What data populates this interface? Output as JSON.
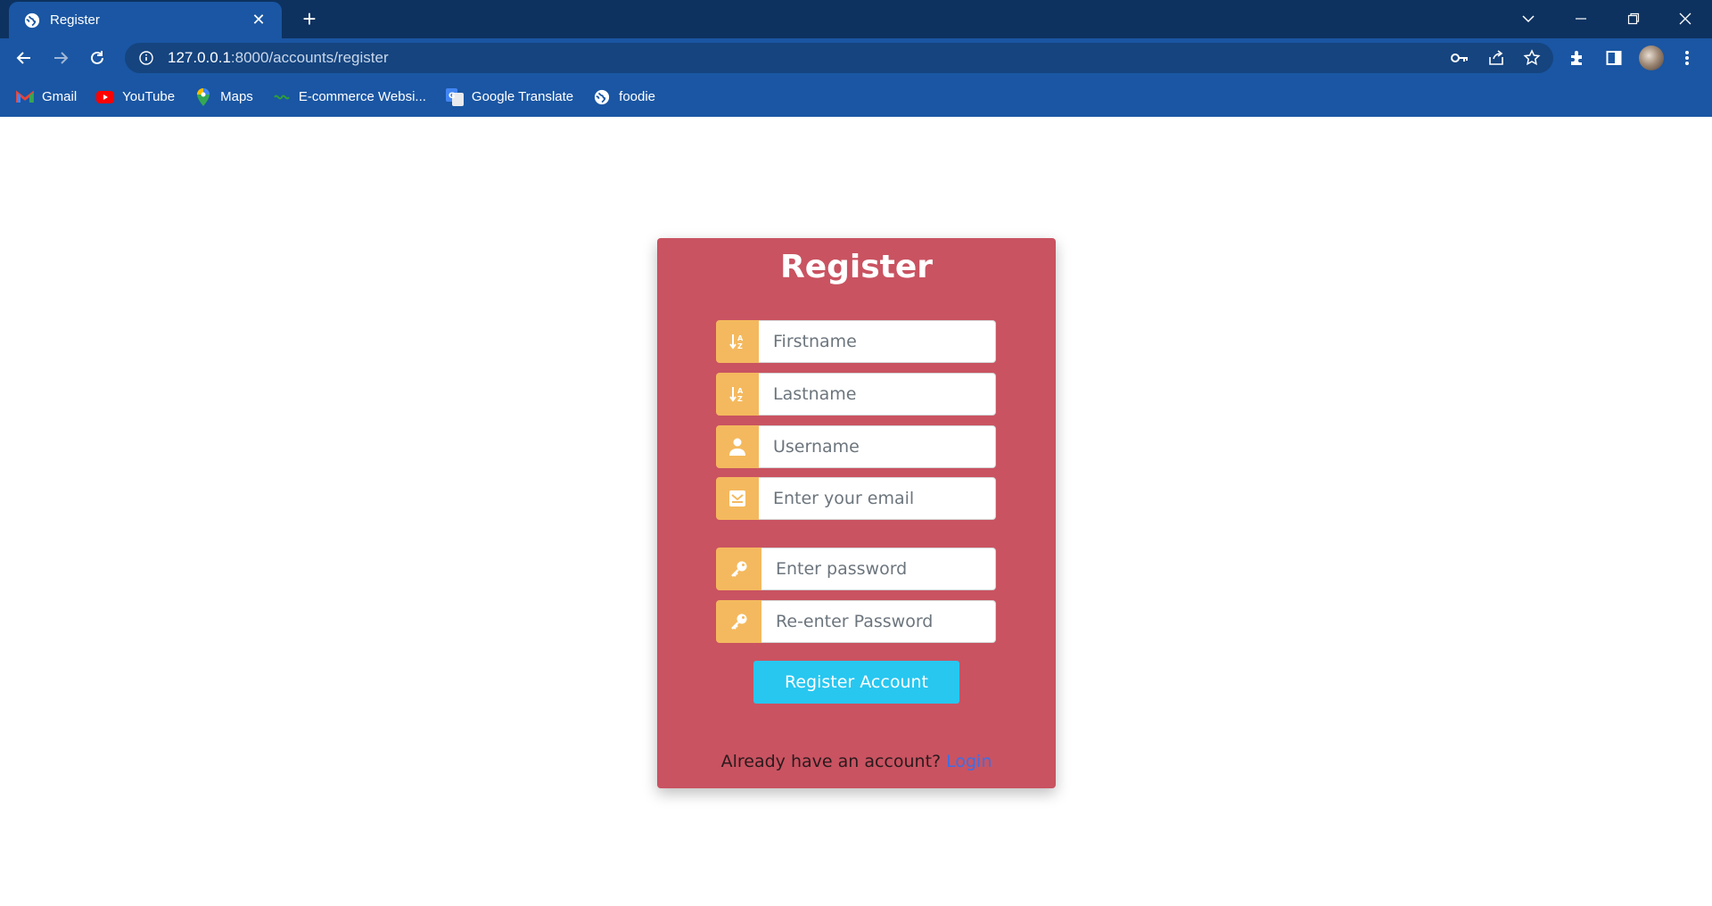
{
  "browser": {
    "tab": {
      "title": "Register",
      "close_glyph": "✕"
    },
    "new_tab_glyph": "+",
    "url": {
      "host": "127.0.0.1",
      "path": ":8000/accounts/register"
    },
    "bookmarks": [
      {
        "label": "Gmail",
        "icon": "gmail-icon"
      },
      {
        "label": "YouTube",
        "icon": "youtube-icon"
      },
      {
        "label": "Maps",
        "icon": "maps-icon"
      },
      {
        "label": "E-commerce Websi...",
        "icon": "ecommerce-icon"
      },
      {
        "label": "Google Translate",
        "icon": "translate-icon"
      },
      {
        "label": "foodie",
        "icon": "globe-icon"
      }
    ]
  },
  "form": {
    "title": "Register",
    "fields": {
      "firstname": {
        "placeholder": "Firstname",
        "icon": "sort-alpha-icon"
      },
      "lastname": {
        "placeholder": "Lastname",
        "icon": "sort-alpha-icon"
      },
      "username": {
        "placeholder": "Username",
        "icon": "user-icon"
      },
      "email": {
        "placeholder": "Enter your email",
        "icon": "envelope-icon"
      },
      "password": {
        "placeholder": "Enter password",
        "icon": "key-icon"
      },
      "password2": {
        "placeholder": "Re-enter Password",
        "icon": "key-icon"
      }
    },
    "submit_label": "Register Account",
    "footer_text": "Already have an account?",
    "login_link": "Login"
  },
  "colors": {
    "card_bg": "#c95361",
    "addon_bg": "#f4b95e",
    "button_bg": "#27c7f0",
    "link": "#3d6ee6",
    "chrome_dark": "#0d3260",
    "chrome": "#1a56a3"
  }
}
